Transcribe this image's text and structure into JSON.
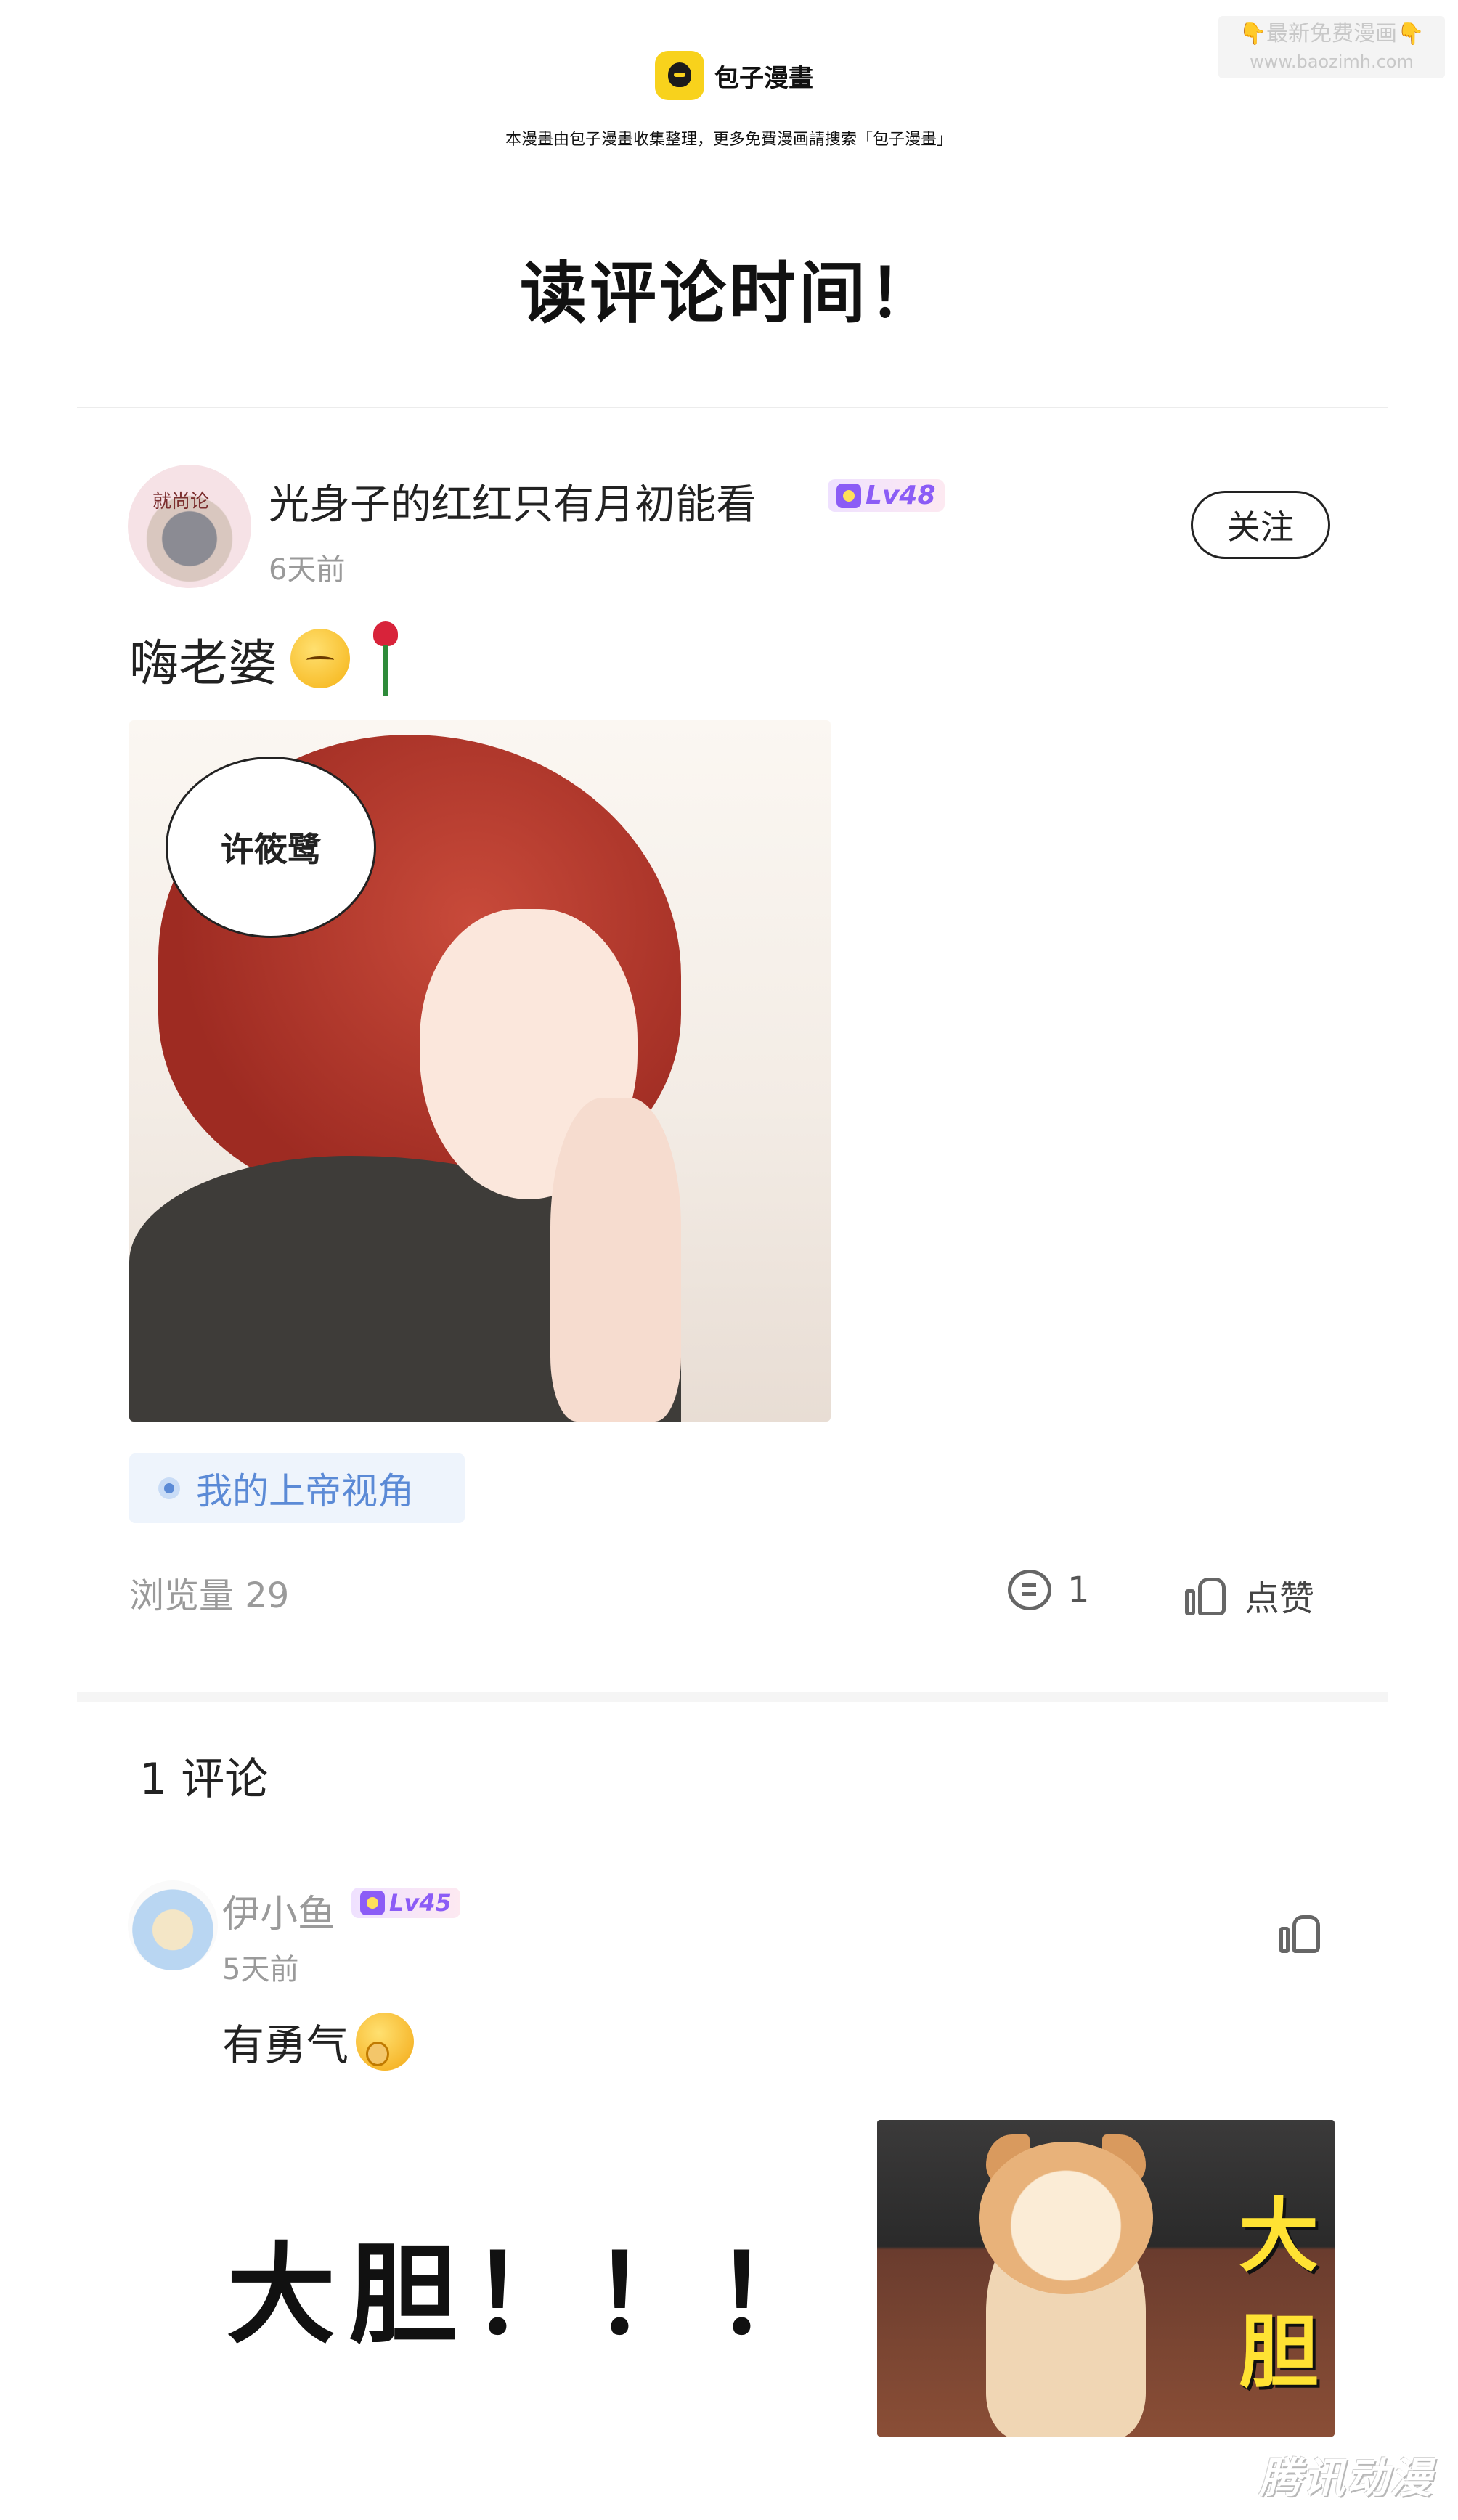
{
  "header": {
    "logo_text": "包子漫畫",
    "subtitle": "本漫畫由包子漫畫收集整理，更多免費漫画請搜索「包子漫畫」",
    "watermark_line1": "👇最新免费漫画👇",
    "watermark_line2": "www.baozimh.com"
  },
  "page_title": "读评论时间！",
  "post": {
    "avatar_tag": "就尚论",
    "username": "光身子的红红只有月初能看",
    "level": "Lv48",
    "time": "6天前",
    "follow_label": "关注",
    "text": "嗨老婆",
    "image_bubble": "许筱鹭",
    "topic": "我的上帝视角",
    "views": "浏览量 29",
    "comment_count": "1",
    "like_label": "点赞"
  },
  "comments": {
    "title": "1 评论",
    "items": [
      {
        "username": "伊小鱼",
        "level": "Lv45",
        "time": "5天前",
        "text": "有勇气",
        "big_text": "大胆！！！",
        "image_label_1": "大",
        "image_label_2": "胆"
      }
    ]
  },
  "footer": {
    "watermark": "腾讯动漫"
  }
}
